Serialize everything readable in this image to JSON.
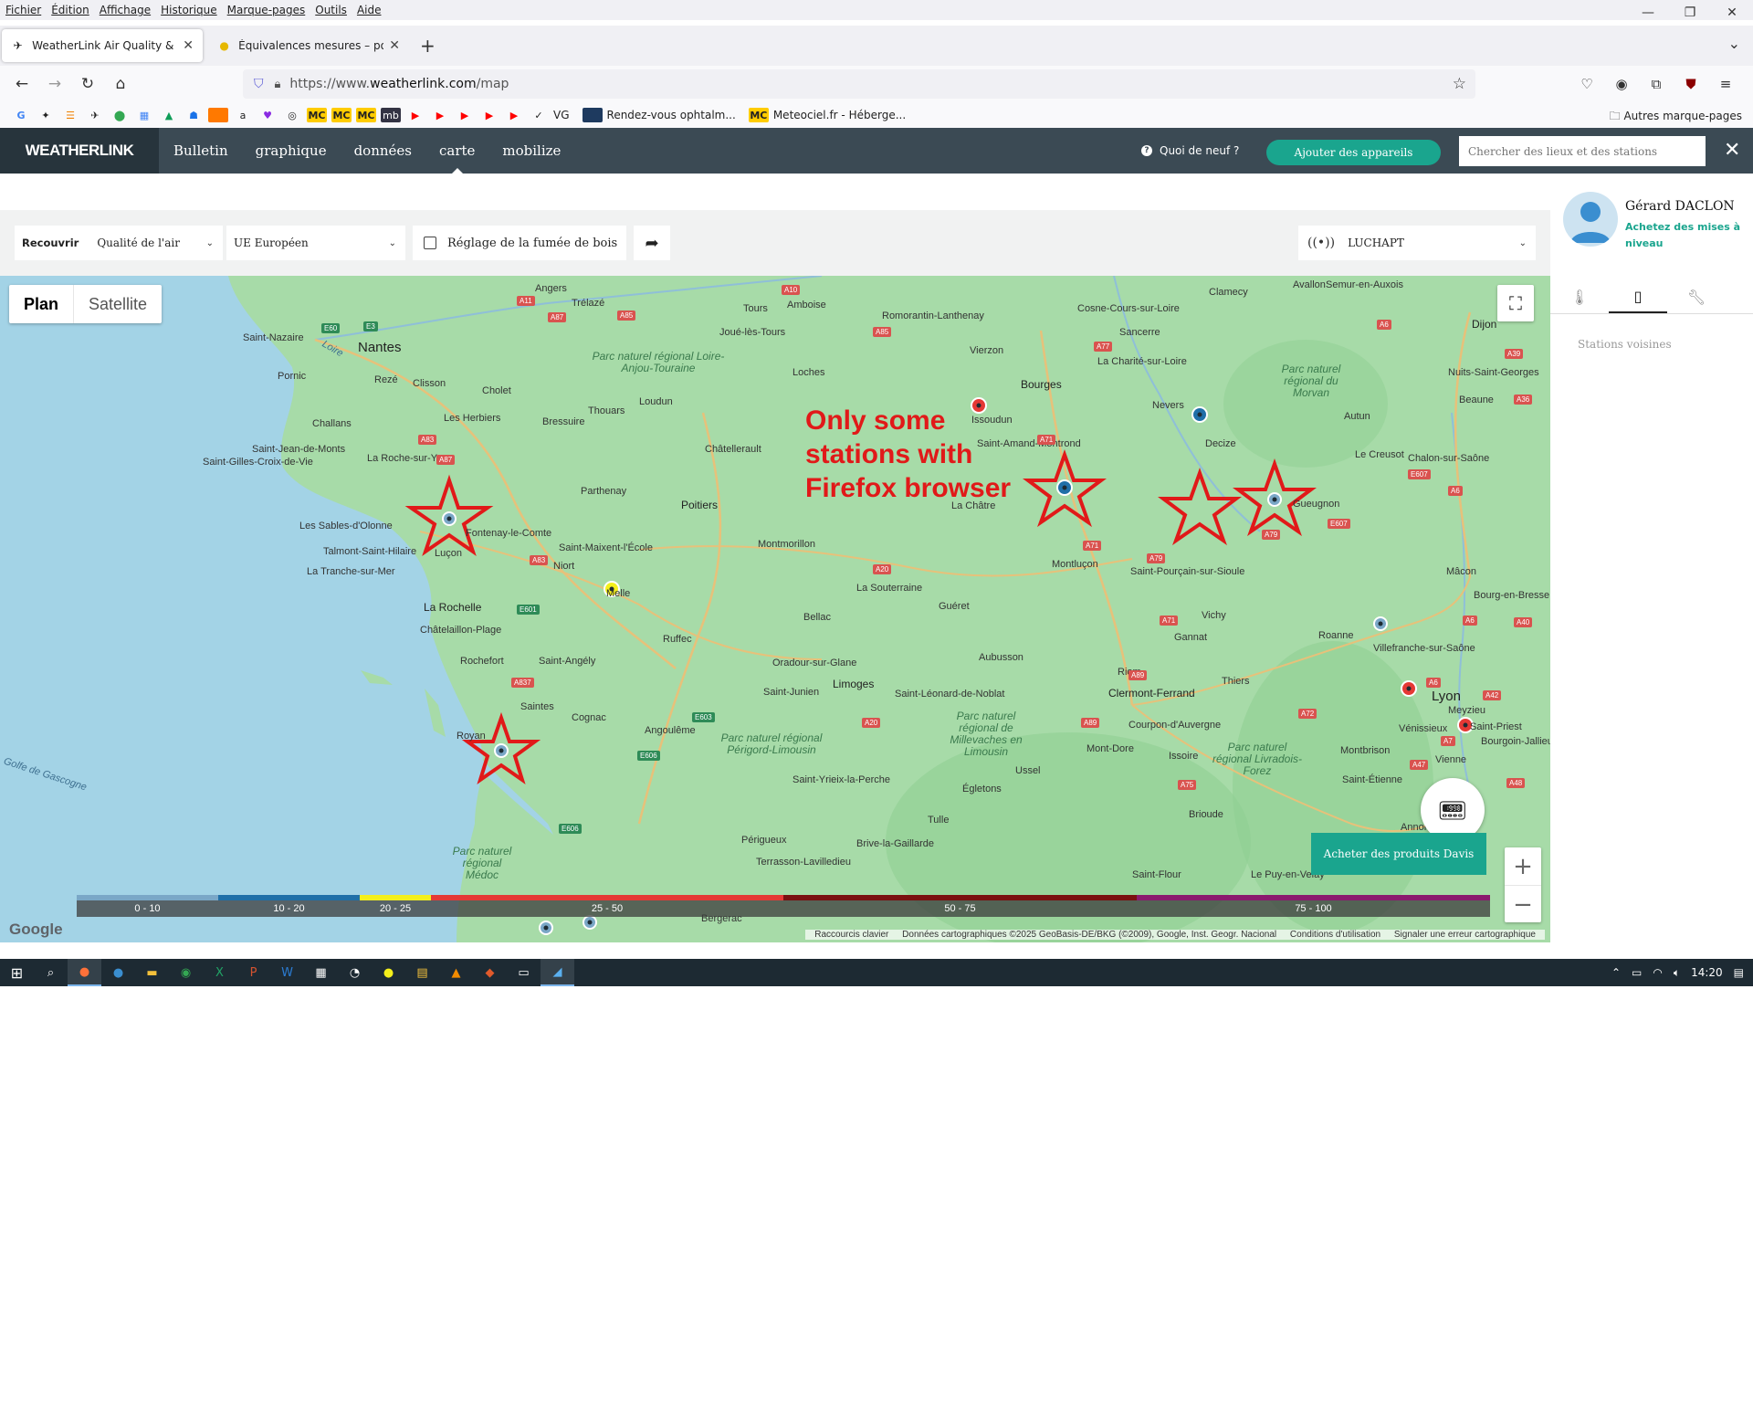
{
  "menubar": [
    "Fichier",
    "Édition",
    "Affichage",
    "Historique",
    "Marque-pages",
    "Outils",
    "Aide"
  ],
  "tabs": [
    {
      "title": "WeatherLink Air Quality & Temp",
      "icon": "weatherlink-favicon"
    },
    {
      "title": "Équivalences mesures – poids | ",
      "icon": "moon-favicon"
    }
  ],
  "url": {
    "prefix": "https://www.",
    "domain": "weatherlink.com",
    "path": "/map"
  },
  "bookmarks": {
    "labelled": [
      "VG",
      "Rendez-vous ophtalm...",
      "Meteociel.fr - Héberge..."
    ],
    "other": "Autres marque-pages"
  },
  "header": {
    "logo": "WEATHERLINK",
    "nav": [
      "Bulletin",
      "graphique",
      "données",
      "carte",
      "mobilize"
    ],
    "selected_nav": "carte",
    "whats_new": "Quoi de neuf ?",
    "add_devices": "Ajouter des appareils",
    "search_placeholder": "Chercher des lieux et des stations"
  },
  "controls": {
    "overlay_label": "Recouvrir",
    "overlay_value": "Qualité de l'air",
    "standard": "UE Européen",
    "wood_smoke": "Réglage de la fumée de bois",
    "station": "LUCHAPT"
  },
  "map": {
    "map_type": [
      "Plan",
      "Satellite"
    ],
    "buy_davis": "Acheter des produits Davis",
    "annotation": [
      "Only some",
      "stations with",
      "Firefox browser"
    ],
    "scale": [
      {
        "label": "0 - 10",
        "color": "#7aa7c7"
      },
      {
        "label": "10 - 20",
        "color": "#1f6fa8"
      },
      {
        "label": "20 - 25",
        "color": "#f4ef1b"
      },
      {
        "label": "25 - 50",
        "color": "#e53935"
      },
      {
        "label": "50 - 75",
        "color": "#7a1010"
      },
      {
        "label": "75 - 100",
        "color": "#8b1a6e"
      }
    ],
    "google": "Google",
    "attribution": [
      "Raccourcis clavier",
      "Données cartographiques ©2025 GeoBasis-DE/BKG (©2009), Google, Inst. Geogr. Nacional",
      "Conditions d'utilisation",
      "Signaler une erreur cartographique"
    ],
    "places": {
      "cities": [
        "Nantes",
        "Poitiers",
        "Limoges",
        "Bourges",
        "Clermont-Ferrand",
        "Lyon",
        "La Rochelle",
        "Dijon"
      ],
      "towns": [
        "Angers",
        "Trélazé",
        "Tours",
        "Amboise",
        "Romorantin-Lanthenay",
        "Cosne-Cours-sur-Loire",
        "Clamecy",
        "Avallon",
        "Semur-en-Auxois",
        "Saint-Nazaire",
        "Joué-lès-Tours",
        "Sancerre",
        "Rezé",
        "Clisson",
        "Pornic",
        "Loches",
        "Vierzon",
        "La Charité-sur-Loire",
        "Nuits-Saint-Georges",
        "Cholet",
        "Loudun",
        "Beaune",
        "Thouars",
        "Issoudun",
        "Nevers",
        "Autun",
        "Challans",
        "Les Herbiers",
        "Bressuire",
        "Châtellerault",
        "Saint-Jean-de-Monts",
        "Saint-Gilles-Croix-de-Vie",
        "La Roche-sur-Yon",
        "Saint-Amand-Montrond",
        "Decize",
        "Le Creusot",
        "Chalon-sur-Saône",
        "Parthenay",
        "La Châtre",
        "Gueugnon",
        "Les Sables-d'Olonne",
        "Fontenay-le-Comte",
        "Talmont-Saint-Hilaire",
        "Luçon",
        "Saint-Maixent-l'École",
        "Montmorillon",
        "La Tranche-sur-Mer",
        "Niort",
        "Montluçon",
        "Saint-Pourçain-sur-Sioule",
        "Mâcon",
        "Melle",
        "La Souterraine",
        "Guéret",
        "Bourg-en-Bresse",
        "Bellac",
        "Vichy",
        "Châtelaillon-Plage",
        "Ruffec",
        "Gannat",
        "Roanne",
        "Villefranche-sur-Saône",
        "Rochefort",
        "Saint-Angély",
        "Aubusson",
        "Oradour-sur-Glane",
        "Riom",
        "Saint-Junien",
        "Saint-Léonard-de-Noblat",
        "Thiers",
        "Saintes",
        "Cognac",
        "Angoulême",
        "Meyzieu",
        "Royan",
        "Vénissieux",
        "Saint-Priest",
        "Bourgoin-Jallieu",
        "Courpon-d'Auvergne",
        "Mont-Dore",
        "Issoire",
        "Montbrison",
        "Ussel",
        "Vienne",
        "Saint-Yrieix-la-Perche",
        "Saint-Étienne",
        "Égletons",
        "Tulle",
        "Brioude",
        "Annonay",
        "Périgueux",
        "Brive-la-Gaillarde",
        "Terrasson-Lavilledieu",
        "Saint-Flour",
        "Le Puy-en-Velay",
        "Bergerac"
      ],
      "parks": [
        "Parc naturel régional Loire-Anjou-Touraine",
        "Parc naturel régional du Morvan",
        "Parc naturel régional Périgord-Limousin",
        "Parc naturel régional de Millevaches en Limousin",
        "Parc naturel régional Livradois-Forez",
        "Parc naturel régional Médoc"
      ],
      "sea": "Golfe de Gascogne",
      "river": "Loire"
    }
  },
  "panel": {
    "user_name": "Gérard DACLON",
    "upgrade": "Achetez des mises à niveau",
    "nearby": "Stations voisines"
  },
  "taskbar": {
    "time": "14:20"
  }
}
